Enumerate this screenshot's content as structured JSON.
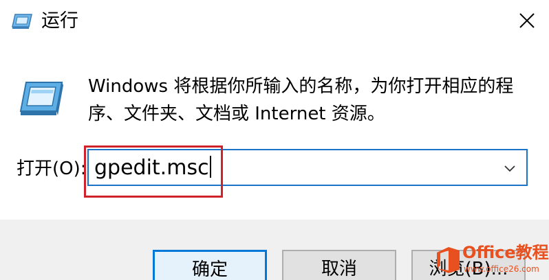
{
  "window": {
    "title": "运行",
    "close_icon": "close-icon"
  },
  "dialog": {
    "description": "Windows 将根据你所输入的名称，为你打开相应的程序、文件夹、文档或 Internet 资源。",
    "open_label": "打开(O):",
    "input_value": "gpedit.msc",
    "icon": "run-icon"
  },
  "buttons": {
    "ok": "确定",
    "cancel": "取消",
    "browse": "浏览(B)..."
  },
  "watermark": {
    "title": "Office教程网",
    "url": "www.office26.com"
  },
  "colors": {
    "focus_border": "#1a73c9",
    "highlight_box": "#d0222b",
    "footer_bg": "#f0f0f0",
    "watermark": "#e8501f"
  }
}
